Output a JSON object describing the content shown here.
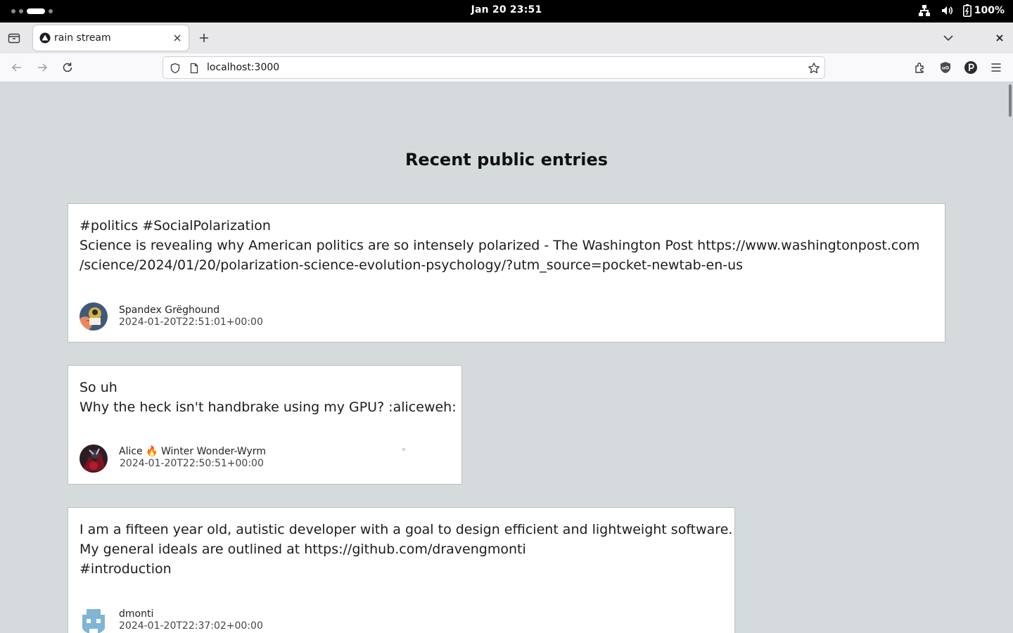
{
  "system": {
    "clock": "Jan 20  23:51",
    "battery": "100%"
  },
  "browser": {
    "tab_title": "rain stream",
    "url": "localhost:3000"
  },
  "page": {
    "heading": "Recent public entries",
    "entries": [
      {
        "text": "#politics #SocialPolarization\nScience is revealing why American politics are so intensely polarized - The Washington Post https://www.washingtonpost.com\n/science/2024/01/20/polarization-science-evolution-psychology/?utm_source=pocket-newtab-en-us",
        "author": "Spandex Grëghound",
        "timestamp": "2024-01-20T22:51:01+00:00"
      },
      {
        "text": "So uh\nWhy the heck isn't handbrake using my GPU? :aliceweh:",
        "author_prefix": "Alice",
        "author_emoji": "🔥",
        "author_suffix": "Winter Wonder-Wyrm",
        "timestamp": "2024-01-20T22:50:51+00:00"
      },
      {
        "text": "I am a fifteen year old, autistic developer with a goal to design efficient and lightweight software.\nMy general ideals are outlined at https://github.com/dravengmonti\n#introduction",
        "author": "dmonti",
        "timestamp": "2024-01-20T22:37:02+00:00"
      }
    ]
  },
  "colors": {
    "page_background": "#d5dbdc",
    "card_background": "#ffffff",
    "card_border": "#bfbfbf"
  },
  "icons": [
    "activities-indicator",
    "network-icon",
    "volume-icon",
    "battery-icon",
    "tab-overview-icon",
    "tab-favicon",
    "tab-close-icon",
    "new-tab-icon",
    "tab-list-icon",
    "window-close-icon",
    "back-icon",
    "forward-icon",
    "reload-icon",
    "shield-icon",
    "page-icon",
    "bookmark-star-icon",
    "extensions-icon",
    "ublock-icon",
    "pocket-icon",
    "menu-icon"
  ]
}
